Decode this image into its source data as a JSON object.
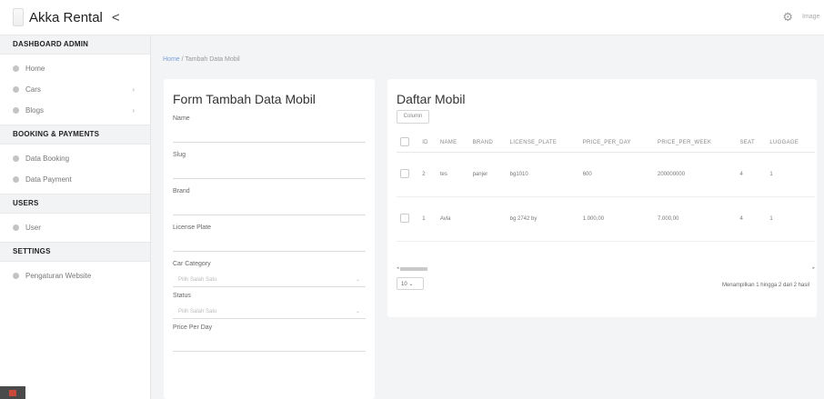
{
  "sidebar": {
    "brand": "Akka Rental",
    "toggle": "<",
    "sections": [
      {
        "title": "DASHBOARD ADMIN",
        "items": [
          {
            "label": "Home",
            "chevron": ""
          },
          {
            "label": "Cars",
            "chevron": "›"
          },
          {
            "label": "Blogs",
            "chevron": "›"
          }
        ]
      },
      {
        "title": "BOOKING & PAYMENTS",
        "items": [
          {
            "label": "Data Booking",
            "chevron": ""
          },
          {
            "label": "Data Payment",
            "chevron": ""
          }
        ]
      },
      {
        "title": "USERS",
        "items": [
          {
            "label": "User",
            "chevron": ""
          }
        ]
      },
      {
        "title": "SETTINGS",
        "items": [
          {
            "label": "Pengaturan Website",
            "chevron": ""
          }
        ]
      }
    ]
  },
  "topbar": {
    "gear_icon": "gear-icon",
    "avatar_text": "Image"
  },
  "breadcrumb": {
    "home": "Home",
    "sep": " / ",
    "current": "Tambah Data Mobil"
  },
  "form": {
    "title": "Form Tambah Data Mobil",
    "fields": [
      {
        "label": "Name",
        "type": "input"
      },
      {
        "label": "Slug",
        "type": "input"
      },
      {
        "label": "Brand",
        "type": "input"
      },
      {
        "label": "License Plate",
        "type": "input"
      },
      {
        "label": "Car Category",
        "type": "select",
        "value": "Pilih Salah Satu"
      },
      {
        "label": "Status",
        "type": "select",
        "value": "Pilih Salah Satu"
      },
      {
        "label": "Price Per Day",
        "type": "input"
      }
    ]
  },
  "table": {
    "title": "Daftar Mobil",
    "colvis": "Column",
    "headers": [
      "",
      "ID",
      "NAME",
      "BRAND",
      "LICENSE_PLATE",
      "PRICE_PER_DAY",
      "PRICE_PER_WEEK",
      "SEAT",
      "LUGGAGE"
    ],
    "rows": [
      [
        "",
        "2",
        "tes",
        "panjer",
        "bg1010",
        "600",
        "200000000",
        "4",
        "1"
      ],
      [
        "",
        "1",
        "Avla",
        "",
        "bg 2742 by",
        "1.000,00",
        "7.000,00",
        "4",
        "1"
      ]
    ],
    "per_page": "10",
    "info": "Menampilkan 1 hingga 2 dari 2 hasil"
  }
}
